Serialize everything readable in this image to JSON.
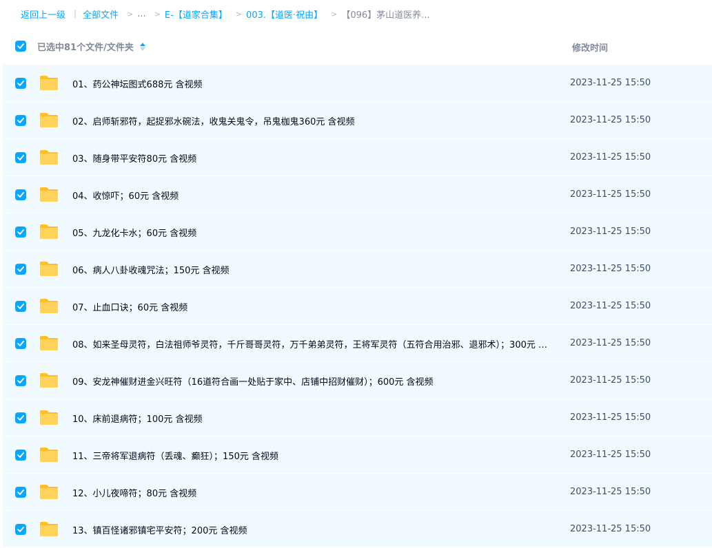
{
  "breadcrumb": {
    "back": "返回上一级",
    "all_files": "全部文件",
    "ellipsis": "...",
    "crumb1": "E-【道家合集】",
    "crumb2": "003.【道医·祝由】",
    "current": "【096】茅山道医养..."
  },
  "header": {
    "selected_label": "已选中81个文件/文件夹",
    "modified_label": "修改时间"
  },
  "colors": {
    "accent": "#06a7ff",
    "row_bg": "#f0faff",
    "folder": "#ffc83d"
  },
  "files": [
    {
      "name": "01、药公神坛图式688元 含视频",
      "time": "2023-11-25 15:50"
    },
    {
      "name": "02、启师斩邪符，起捉邪水碗法，收鬼关鬼令，吊鬼枷鬼360元 含视频",
      "time": "2023-11-25 15:50"
    },
    {
      "name": "03、随身带平安符80元 含视频",
      "time": "2023-11-25 15:50"
    },
    {
      "name": "04、收惊吓；60元 含视频",
      "time": "2023-11-25 15:50"
    },
    {
      "name": "05、九龙化卡水；60元 含视频",
      "time": "2023-11-25 15:50"
    },
    {
      "name": "06、病人八卦收魂咒法；150元 含视频",
      "time": "2023-11-25 15:50"
    },
    {
      "name": "07、止血口诀；60元 含视频",
      "time": "2023-11-25 15:50"
    },
    {
      "name": "08、如来圣母灵符，白法祖师爷灵符，千斤哥哥灵符，万千弟弟灵符，王将军灵符（五符合用治邪、退邪术）；300元 含...",
      "time": "2023-11-25 15:50"
    },
    {
      "name": "09、安龙神催财进金兴旺符（16道符合画一处贴于家中、店铺中招财催财）；600元 含视频",
      "time": "2023-11-25 15:50"
    },
    {
      "name": "10、床前退病符；100元 含视频",
      "time": "2023-11-25 15:50"
    },
    {
      "name": "11、三帝将军退病符（丢魂、癫狂）；150元 含视频",
      "time": "2023-11-25 15:50"
    },
    {
      "name": "12、小儿夜啼符；80元 含视频",
      "time": "2023-11-25 15:50"
    },
    {
      "name": "13、镇百怪诸邪镇宅平安符；200元 含视频",
      "time": "2023-11-25 15:50"
    }
  ]
}
